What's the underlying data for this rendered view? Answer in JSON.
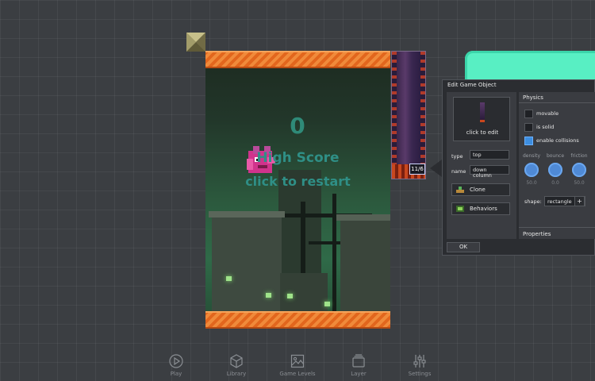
{
  "colors": {
    "background": "#3b3e42",
    "orange_bar": "#e2661d",
    "score_text": "#2f8a78",
    "teal_shape": "#58efc3",
    "dialog_bg": "#2b2d31",
    "checkbox_on": "#3d8ee0",
    "knob": "#4f8ad6"
  },
  "game": {
    "score": "0",
    "high_score_label": "High Score",
    "restart_label": "click to restart",
    "column_label": "11/6"
  },
  "dialog": {
    "title": "Edit Game Object",
    "thumbnail_label": "click to edit",
    "type_label": "type",
    "type_value": "top",
    "name_label": "name",
    "name_value": "down column",
    "clone_label": "Clone",
    "behaviors_label": "Behaviors",
    "physics_title": "Physics",
    "checkboxes": [
      {
        "label": "movable",
        "checked": false
      },
      {
        "label": "is solid",
        "checked": false
      },
      {
        "label": "enable collisions",
        "checked": true
      }
    ],
    "knobs": [
      {
        "label": "density",
        "value": "50.0"
      },
      {
        "label": "bounce",
        "value": "0.0"
      },
      {
        "label": "friction",
        "value": "50.0"
      }
    ],
    "shape_label": "shape:",
    "shape_value": "rectangle",
    "shape_plus": "+",
    "properties_title": "Properties",
    "ok_label": "OK"
  },
  "toolbar": [
    {
      "label": "Play",
      "icon": "play-icon"
    },
    {
      "label": "Library",
      "icon": "cube-icon"
    },
    {
      "label": "Game Levels",
      "icon": "image-icon"
    },
    {
      "label": "Layer",
      "icon": "layers-icon"
    },
    {
      "label": "Settings",
      "icon": "sliders-icon"
    }
  ]
}
